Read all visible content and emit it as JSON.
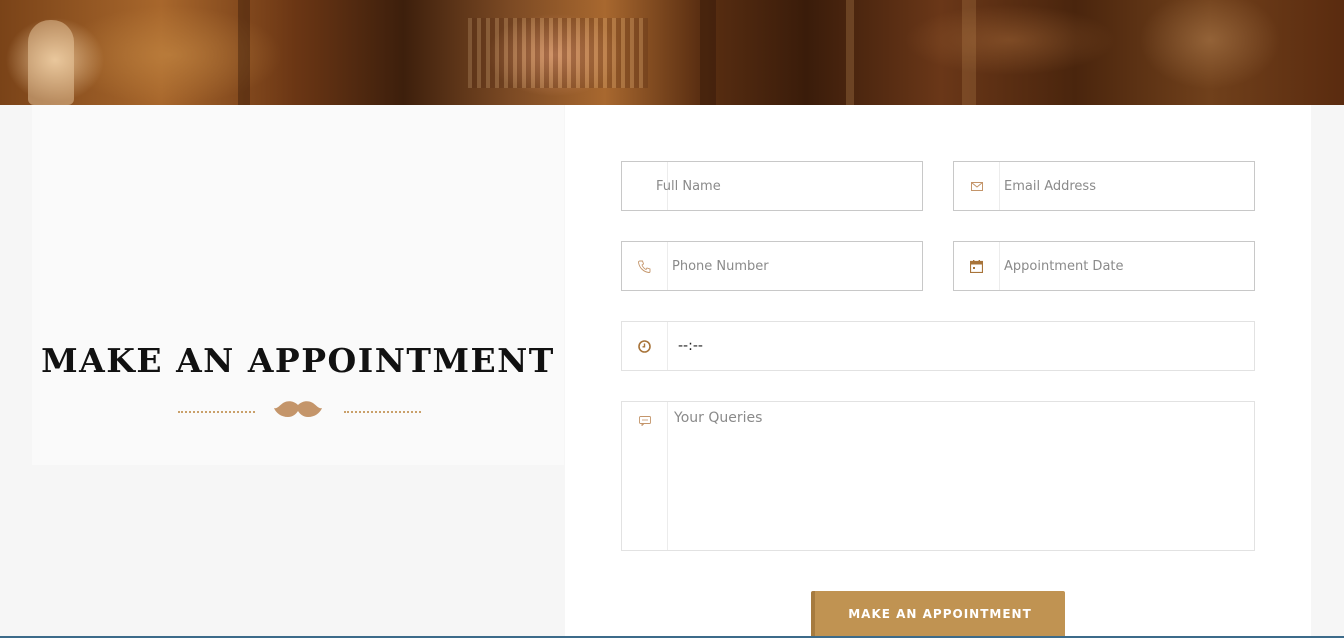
{
  "section": {
    "title": "MAKE AN APPOINTMENT"
  },
  "form": {
    "full_name_placeholder": "Full Name",
    "email_placeholder": "Email Address",
    "phone_placeholder": "Phone Number",
    "date_placeholder": "Appointment Date",
    "time_value": "--:--",
    "queries_placeholder": "Your Queries",
    "submit_label": "MAKE AN APPOINTMENT"
  },
  "colors": {
    "accent": "#c09352",
    "title": "#111111",
    "icon": "#c4956a"
  },
  "icons": {
    "email": "envelope-icon",
    "phone": "phone-icon",
    "date": "calendar-icon",
    "time": "clock-icon",
    "queries": "comment-icon",
    "divider": "mustache-icon"
  }
}
